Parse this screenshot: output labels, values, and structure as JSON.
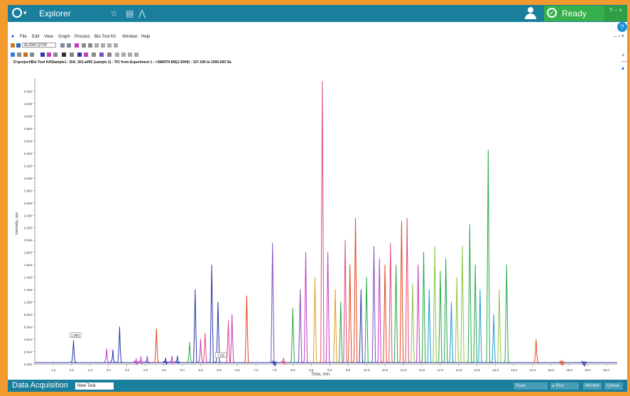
{
  "app": {
    "title": "Explorer",
    "status": "Ready",
    "bottom_label": "Data Acquisition",
    "bottom_tab": "New Task",
    "bottom_controls": [
      "Scan",
      "▸ Run",
      "Monitor",
      "Queue"
    ]
  },
  "menu": [
    "File",
    "Edit",
    "View",
    "Graph",
    "Process",
    "Bio Tool Kit",
    "Window",
    "Help"
  ],
  "toolbar": {
    "combo_value": "AL3000 QTOF"
  },
  "path_line": "D:\\project\\Bio Tool Kit\\Sample1 : DIA_001.wiff2 (sample 1) : TIC from Experiment 1 : +SWATH MS(1-5000) : 157.194 to 1500.000 Da",
  "chart_data": {
    "type": "line",
    "xlabel": "Time, min",
    "ylabel": "Intensity, cps",
    "xlim": [
      1,
      16.8
    ],
    "ylim": [
      0,
      460000.0
    ],
    "x_ticks": [
      1.5,
      2.0,
      2.5,
      3.0,
      3.5,
      4.0,
      4.5,
      5.0,
      5.5,
      6.0,
      6.5,
      7.0,
      7.5,
      8.0,
      8.5,
      9.0,
      9.5,
      10.0,
      10.5,
      11.0,
      11.5,
      12.0,
      12.5,
      13.0,
      13.5,
      14.0,
      14.5,
      15.0,
      15.5,
      16.0,
      16.5
    ],
    "y_ticks": [
      "0.0e0",
      "2.0e4",
      "4.0e4",
      "6.0e4",
      "8.0e4",
      "1.0e5",
      "1.2e5",
      "1.4e5",
      "1.6e5",
      "1.8e5",
      "2.0e5",
      "2.2e5",
      "2.4e5",
      "2.6e5",
      "2.8e5",
      "3.0e5",
      "3.2e5",
      "3.4e5",
      "3.6e5",
      "3.8e5",
      "4.0e5",
      "4.2e5",
      "4.4e5"
    ],
    "annotations": [
      {
        "text": "1.992",
        "x": 2.1,
        "y": 38000.0
      },
      {
        "text": "7.03",
        "x": 6.05,
        "y": 6000.0
      }
    ],
    "series_colors": [
      "#2b3aa8",
      "#c43cc0",
      "#e6461f",
      "#e0a020",
      "#27a84a",
      "#8cc63f",
      "#1e9ad6",
      "#7d4cc4",
      "#e24a7a"
    ],
    "peaks": [
      {
        "x": 2.05,
        "y": 38000.0,
        "c": 0
      },
      {
        "x": 2.95,
        "y": 25000.0,
        "c": 1
      },
      {
        "x": 3.12,
        "y": 23000.0,
        "c": 0
      },
      {
        "x": 3.3,
        "y": 60000.0,
        "c": 0
      },
      {
        "x": 3.75,
        "y": 9000.0,
        "c": 1
      },
      {
        "x": 3.88,
        "y": 12000.0,
        "c": 1
      },
      {
        "x": 4.05,
        "y": 13000.0,
        "c": 7
      },
      {
        "x": 4.3,
        "y": 57000.0,
        "c": 2
      },
      {
        "x": 4.55,
        "y": 10000.0,
        "c": 0
      },
      {
        "x": 4.72,
        "y": 13000.0,
        "c": 1
      },
      {
        "x": 4.87,
        "y": 13000.0,
        "c": 0
      },
      {
        "x": 5.2,
        "y": 35000.0,
        "c": 4
      },
      {
        "x": 5.35,
        "y": 120000.0,
        "c": 0
      },
      {
        "x": 5.5,
        "y": 40000.0,
        "c": 1
      },
      {
        "x": 5.62,
        "y": 50000.0,
        "c": 8
      },
      {
        "x": 5.8,
        "y": 160000.0,
        "c": 0
      },
      {
        "x": 5.97,
        "y": 100000.0,
        "c": 0
      },
      {
        "x": 6.25,
        "y": 70000.0,
        "c": 8
      },
      {
        "x": 6.35,
        "y": 80000.0,
        "c": 1
      },
      {
        "x": 6.75,
        "y": 110000.0,
        "c": 2
      },
      {
        "x": 7.45,
        "y": 195000.0,
        "c": 7
      },
      {
        "x": 7.5,
        "y": 5000.0,
        "c": 0
      },
      {
        "x": 7.75,
        "y": 10000.0,
        "c": 8
      },
      {
        "x": 8.0,
        "y": 90000.0,
        "c": 4
      },
      {
        "x": 8.2,
        "y": 120000.0,
        "c": 7
      },
      {
        "x": 8.35,
        "y": 180000.0,
        "c": 1
      },
      {
        "x": 8.6,
        "y": 140000.0,
        "c": 3
      },
      {
        "x": 8.8,
        "y": 456000.0,
        "c": 8
      },
      {
        "x": 8.95,
        "y": 180000.0,
        "c": 1
      },
      {
        "x": 9.15,
        "y": 120000.0,
        "c": 3
      },
      {
        "x": 9.3,
        "y": 100000.0,
        "c": 4
      },
      {
        "x": 9.42,
        "y": 200000.0,
        "c": 8
      },
      {
        "x": 9.55,
        "y": 160000.0,
        "c": 2
      },
      {
        "x": 9.7,
        "y": 235000.0,
        "c": 2
      },
      {
        "x": 9.85,
        "y": 120000.0,
        "c": 0
      },
      {
        "x": 10.0,
        "y": 140000.0,
        "c": 4
      },
      {
        "x": 10.2,
        "y": 190000.0,
        "c": 7
      },
      {
        "x": 10.35,
        "y": 170000.0,
        "c": 1
      },
      {
        "x": 10.5,
        "y": 160000.0,
        "c": 2
      },
      {
        "x": 10.65,
        "y": 195000.0,
        "c": 8
      },
      {
        "x": 10.8,
        "y": 160000.0,
        "c": 4
      },
      {
        "x": 10.95,
        "y": 230000.0,
        "c": 2
      },
      {
        "x": 11.1,
        "y": 235000.0,
        "c": 8
      },
      {
        "x": 11.25,
        "y": 130000.0,
        "c": 5
      },
      {
        "x": 11.4,
        "y": 160000.0,
        "c": 1
      },
      {
        "x": 11.55,
        "y": 180000.0,
        "c": 4
      },
      {
        "x": 11.7,
        "y": 120000.0,
        "c": 6
      },
      {
        "x": 11.85,
        "y": 190000.0,
        "c": 5
      },
      {
        "x": 12.0,
        "y": 150000.0,
        "c": 4
      },
      {
        "x": 12.15,
        "y": 170000.0,
        "c": 4
      },
      {
        "x": 12.3,
        "y": 100000.0,
        "c": 6
      },
      {
        "x": 12.45,
        "y": 140000.0,
        "c": 5
      },
      {
        "x": 12.6,
        "y": 190000.0,
        "c": 5
      },
      {
        "x": 12.8,
        "y": 225000.0,
        "c": 4
      },
      {
        "x": 12.95,
        "y": 160000.0,
        "c": 4
      },
      {
        "x": 13.08,
        "y": 120000.0,
        "c": 6
      },
      {
        "x": 13.3,
        "y": 345000.0,
        "c": 4
      },
      {
        "x": 13.45,
        "y": 80000.0,
        "c": 6
      },
      {
        "x": 13.6,
        "y": 120000.0,
        "c": 5
      },
      {
        "x": 13.8,
        "y": 160000.0,
        "c": 4
      },
      {
        "x": 14.6,
        "y": 40000.0,
        "c": 2
      },
      {
        "x": 15.3,
        "y": 6000.0,
        "c": 2
      },
      {
        "x": 15.9,
        "y": 4000.0,
        "c": 0
      }
    ]
  }
}
